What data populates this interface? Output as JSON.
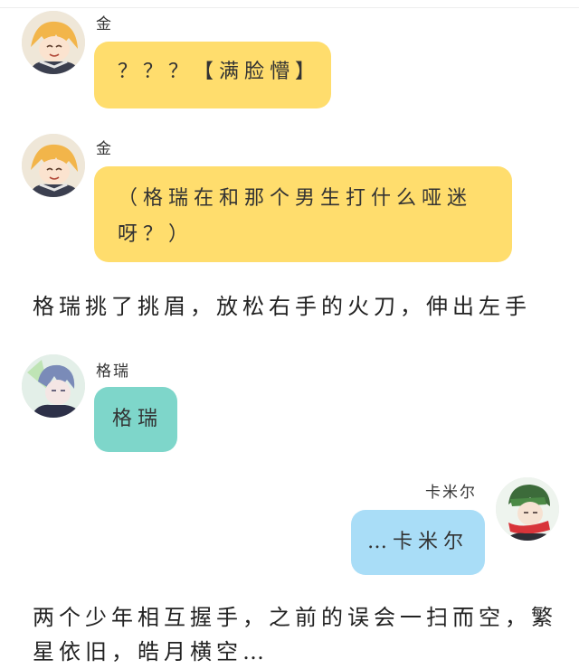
{
  "messages": [
    {
      "speaker": "金",
      "text": "？？？【满脸懵】"
    },
    {
      "speaker": "金",
      "text": "（格瑞在和那个男生打什么哑迷呀？）"
    },
    {
      "speaker": "格瑞",
      "text": "格瑞"
    },
    {
      "speaker": "卡米尔",
      "text": "…卡米尔"
    }
  ],
  "narration": [
    "格瑞挑了挑眉，放松右手的火刀，伸出左手",
    "两个少年相互握手，之前的误会一扫而空，繁星依旧，皓月横空…"
  ],
  "colors": {
    "bubble_yellow": "#ffdd6d",
    "bubble_teal": "#7ed6ca",
    "bubble_blue": "#a9ddf7"
  },
  "avatars": [
    "jin-avatar",
    "jin-avatar",
    "grey-avatar",
    "kamir-avatar"
  ]
}
